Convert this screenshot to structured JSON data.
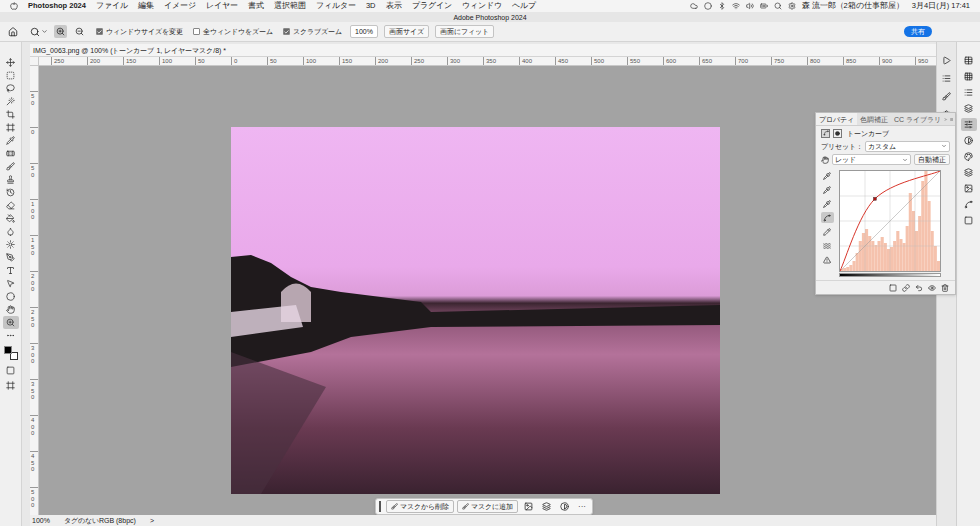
{
  "menu_bar": {
    "app": "Photoshop 2024",
    "items": [
      "ファイル",
      "編集",
      "イメージ",
      "レイヤー",
      "書式",
      "選択範囲",
      "フィルター",
      "3D",
      "表示",
      "プラグイン",
      "ウィンドウ",
      "ヘルプ"
    ],
    "user": "森 流一郎（2箱の仕事部屋）",
    "clock": "3月4日(月) 17:41"
  },
  "window": {
    "title": "Adobe Photoshop 2024"
  },
  "options_bar": {
    "zoom_modes": [
      {
        "selected": true
      },
      {
        "selected": false
      }
    ],
    "checkboxes": [
      {
        "label": "ウィンドウサイズを変更",
        "checked": true
      },
      {
        "label": "全ウィンドウをズーム",
        "checked": false
      },
      {
        "label": "スクラブズーム",
        "checked": true
      }
    ],
    "zoom_field": "100%",
    "buttons": [
      "画面サイズ",
      "画面にフィット"
    ],
    "share": "共有"
  },
  "document_tab": {
    "title": "IMG_0063.png @ 100% (トーンカーブ 1, レイヤーマスク/8) *"
  },
  "rulers": {
    "top": [
      "250",
      "200",
      "150",
      "100",
      "50",
      "0",
      "50",
      "100",
      "150",
      "200",
      "250",
      "300",
      "350",
      "400",
      "450",
      "500",
      "550",
      "600",
      "650",
      "700",
      "750",
      "800",
      "850",
      "900",
      "950"
    ],
    "left": [
      "50",
      "0",
      "50",
      "100",
      "150",
      "200",
      "250",
      "300",
      "350",
      "400",
      "450",
      "500"
    ]
  },
  "tools": [
    {
      "selected": false
    },
    {
      "selected": false
    },
    {
      "selected": false
    },
    {
      "selected": false
    },
    {
      "selected": false
    },
    {
      "selected": false
    },
    {
      "selected": false
    },
    {
      "selected": false
    },
    {
      "selected": false
    },
    {
      "selected": false
    },
    {
      "selected": false
    },
    {
      "selected": false
    },
    {
      "selected": false
    },
    {
      "selected": false
    },
    {
      "selected": false
    },
    {
      "selected": false
    },
    {
      "selected": false
    },
    {
      "selected": false
    },
    {
      "selected": false
    },
    {
      "selected": false
    },
    {
      "selected": true
    },
    {
      "selected": false
    }
  ],
  "dock": {
    "left_strip": [
      {
        "selected": false
      },
      {
        "selected": false
      },
      {
        "selected": false
      },
      {
        "selected": false
      }
    ],
    "right_strip": [
      {
        "selected": false
      },
      {
        "selected": false
      },
      {
        "selected": false
      },
      {
        "selected": false
      },
      {
        "selected": true
      },
      {
        "selected": false
      },
      {
        "selected": false
      },
      {
        "selected": false
      },
      {
        "selected": false
      },
      {
        "selected": false
      },
      {
        "selected": false
      }
    ]
  },
  "properties": {
    "tabs": [
      {
        "label": "プロパティ",
        "selected": true
      },
      {
        "label": "色調補正",
        "selected": false
      },
      {
        "label": "CC ライブラリ",
        "selected": false
      }
    ],
    "title": "トーンカーブ",
    "preset_label": "プリセット：",
    "preset_value": "カスタム",
    "channel": "レッド",
    "auto_button": "自動補正",
    "curve_tools": [
      {
        "selected": false
      },
      {
        "selected": false
      },
      {
        "selected": false
      },
      {
        "selected": true
      },
      {
        "selected": false
      },
      {
        "selected": false
      },
      {
        "selected": false
      }
    ],
    "curve": {
      "points": [
        [
          0,
          0
        ],
        [
          89,
          184
        ],
        [
          255,
          255
        ]
      ],
      "histogram": [
        2,
        3,
        4,
        6,
        10,
        18,
        30,
        38,
        42,
        35,
        30,
        26,
        30,
        34,
        28,
        22,
        24,
        30,
        40,
        32,
        28,
        45,
        78,
        60,
        40,
        55,
        90,
        100,
        70,
        40,
        25,
        10
      ]
    }
  },
  "taskbar": {
    "buttons": [
      "マスクから削除",
      "マスクに追加"
    ],
    "more": "···"
  },
  "status_bar": {
    "zoom": "100%",
    "profile": "タグのないRGB (8bpc)",
    "arrow": ">"
  }
}
